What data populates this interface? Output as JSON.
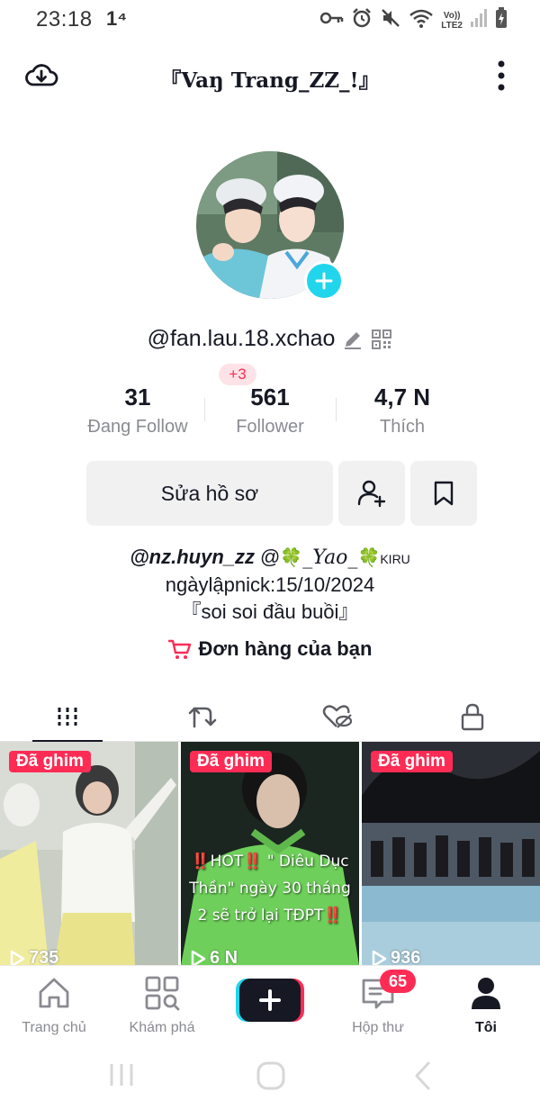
{
  "status_bar": {
    "time": "23:18",
    "extra": "1⁴",
    "icons": [
      "key-icon",
      "alarm-icon",
      "mute-icon",
      "wifi-icon",
      "volte-icon",
      "signal-icon",
      "battery-icon"
    ],
    "volte_text": "Vo))",
    "lte_text": "LTE2"
  },
  "header": {
    "title": "『Vaŋ Trang_ZZ_!』"
  },
  "profile": {
    "username": "@fan.lau.18.xchao",
    "stats": [
      {
        "value": "31",
        "label": "Đang Follow"
      },
      {
        "value": "561",
        "label": "Follower"
      },
      {
        "value": "4,7 N",
        "label": "Thích"
      }
    ],
    "follower_delta": "+3",
    "edit_button": "Sửa hồ sơ",
    "bio": {
      "mention1": "@nz.huyn_zz",
      "mention2_prefix": "@",
      "mention2_name": "_Yao_",
      "mention2_suffix": "KIRU",
      "line2": "ngàylậpnick:15/10/2024",
      "line3": "『soi soi đầu buồi』"
    },
    "orders": "Đơn hàng của bạn"
  },
  "tabs": [
    "videos-grid-icon",
    "repost-icon",
    "liked-hidden-icon",
    "lock-icon"
  ],
  "videos": [
    {
      "badge": "Đã ghim",
      "views": "735",
      "overlay": ""
    },
    {
      "badge": "Đã ghim",
      "views": "6 N",
      "overlay_parts": [
        "‼️",
        "HOT",
        "‼️",
        " \" Diêu Dục Thần\" ngày 30 tháng 2 sẽ trở lại TĐPT",
        "‼️"
      ]
    },
    {
      "badge": "Đã ghim",
      "views": "936",
      "overlay": ""
    }
  ],
  "bottom_nav": {
    "items": [
      {
        "label": "Trang chủ",
        "icon": "home-icon"
      },
      {
        "label": "Khám phá",
        "icon": "discover-icon"
      },
      {
        "label": "",
        "icon": "create-plus-icon"
      },
      {
        "label": "Hộp thư",
        "icon": "inbox-icon"
      },
      {
        "label": "Tôi",
        "icon": "profile-icon"
      }
    ],
    "inbox_badge": "65"
  },
  "colors": {
    "accent_red": "#fe2c55",
    "accent_cyan": "#20d5ec",
    "text_primary": "#161823",
    "text_secondary": "#8a8b91",
    "button_bg": "#f1f1f2"
  }
}
